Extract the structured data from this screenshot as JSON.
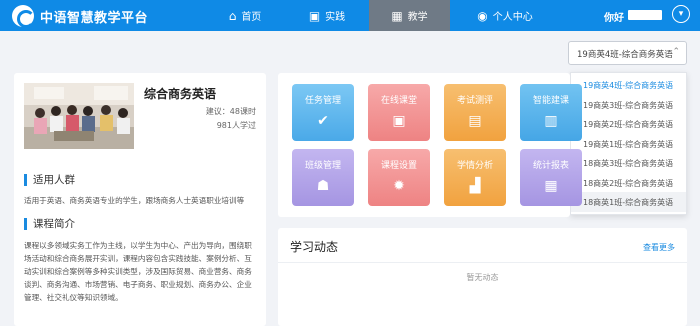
{
  "header": {
    "app_title": "中语智慧教学平台",
    "nav": [
      {
        "label": "首页",
        "icon": "home-icon"
      },
      {
        "label": "实践",
        "icon": "play-icon"
      },
      {
        "label": "教学",
        "icon": "grid-icon",
        "active": true
      },
      {
        "label": "个人中心",
        "icon": "user-icon"
      }
    ],
    "greeting": "你好"
  },
  "class_select": {
    "value": "19商英4班-综合商务英语",
    "options": [
      "19商英4班-综合商务英语",
      "19商英3班-综合商务英语",
      "19商英2班-综合商务英语",
      "19商英1班-综合商务英语",
      "18商英3班-综合商务英语",
      "18商英2班-综合商务英语",
      "18商英1班-综合商务英语"
    ]
  },
  "course": {
    "title": "综合商务英语",
    "suggest": "建议：48课时",
    "students": "981人学过",
    "audience_title": "适用人群",
    "audience_text": "适用于英语、商务英语专业的学生，跟场商务人士英语职业培训等",
    "intro_title": "课程简介",
    "intro_text": "课程以多领域实务工作为主线，以学生为中心、产出为导向，围绕职场活动和综合商务展开实训，课程内容包含实践技能、案例分析、互动实训和综合案例等多种实训类型，涉及国际贸易、商业营务、商务谈判、商务沟通、市场营销、电子商务、职业规划、商务办公、企业管理、社交礼仪等知识领域。"
  },
  "tiles": [
    {
      "label": "任务管理",
      "icon": "task-icon",
      "color": "#5cb6ee"
    },
    {
      "label": "在线课堂",
      "icon": "classroom-icon",
      "color": "#f08c8c"
    },
    {
      "label": "考试测评",
      "icon": "exam-icon",
      "color": "#f3aa4e"
    },
    {
      "label": "智能建课",
      "icon": "build-course-icon",
      "color": "#4fb0e7"
    },
    {
      "label": "班级管理",
      "icon": "class-manage-icon",
      "color": "#ad9ee6"
    },
    {
      "label": "课程设置",
      "icon": "settings-icon",
      "color": "#f08c8c"
    },
    {
      "label": "学情分析",
      "icon": "analysis-icon",
      "color": "#f3aa4e"
    },
    {
      "label": "统计报表",
      "icon": "report-icon",
      "color": "#ad9ee6"
    }
  ],
  "study": {
    "title": "学习动态",
    "more": "查看更多",
    "empty": "暂无动态"
  }
}
